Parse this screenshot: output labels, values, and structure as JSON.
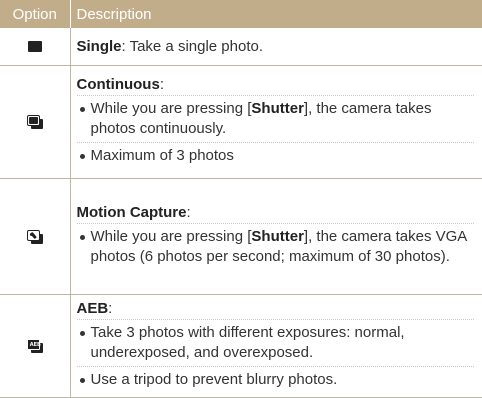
{
  "table": {
    "headers": {
      "option": "Option",
      "description": "Description"
    },
    "rows": [
      {
        "icon": "single-shot-icon",
        "name": "Single",
        "text": ": Take a single photo."
      },
      {
        "icon": "continuous-shot-icon",
        "name": "Continuous",
        "colon": ":",
        "bullets": [
          {
            "pre": "While you are pressing [",
            "key": "Shutter",
            "post": "], the camera takes photos continuously."
          },
          {
            "text": "Maximum of 3 photos"
          }
        ]
      },
      {
        "icon": "motion-capture-icon",
        "name": "Motion Capture",
        "colon": ":",
        "bullets": [
          {
            "pre": "While you are pressing [",
            "key": "Shutter",
            "post": "], the camera takes VGA photos (6 photos per second; maximum of 30 photos)."
          }
        ]
      },
      {
        "icon": "aeb-icon",
        "icon_tag": "AEB",
        "name": "AEB",
        "colon": ":",
        "bullets": [
          {
            "text": "Take 3 photos with different exposures: normal, underexposed, and overexposed."
          },
          {
            "text": "Use a tripod to prevent blurry photos."
          }
        ]
      }
    ]
  },
  "colors": {
    "header_bg": "#c2ad8b",
    "rule": "#bfb6a6",
    "text": "#333333"
  }
}
